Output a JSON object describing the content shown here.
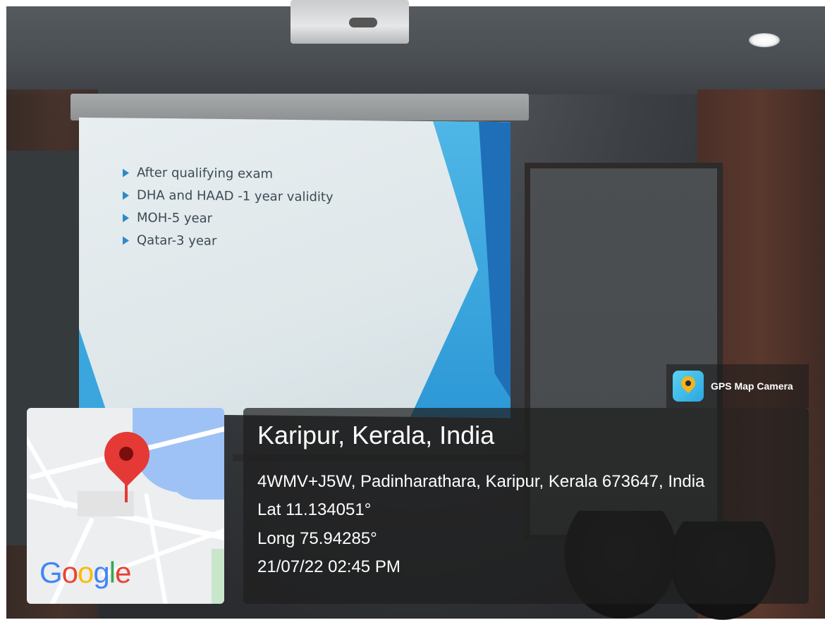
{
  "slide": {
    "bullets": [
      "After qualifying exam",
      "DHA and HAAD -1 year validity",
      "MOH-5 year",
      "Qatar-3 year"
    ]
  },
  "gps_overlay": {
    "app_name": "GPS Map Camera",
    "place_title": "Karipur, Kerala, India",
    "address": "4WMV+J5W, Padinharathara, Karipur, Kerala 673647, India",
    "latitude": "Lat 11.134051°",
    "longitude": "Long 75.94285°",
    "timestamp": "21/07/22 02:45 PM"
  },
  "map": {
    "brand": {
      "g1": "G",
      "o1": "o",
      "o2": "o",
      "g2": "g",
      "l": "l",
      "e": "e"
    },
    "marker_icon": "map-pin-icon"
  },
  "colors": {
    "slide_accent": "#2e89c9",
    "pin_red": "#e53935",
    "water_blue": "#9ec2f5"
  }
}
